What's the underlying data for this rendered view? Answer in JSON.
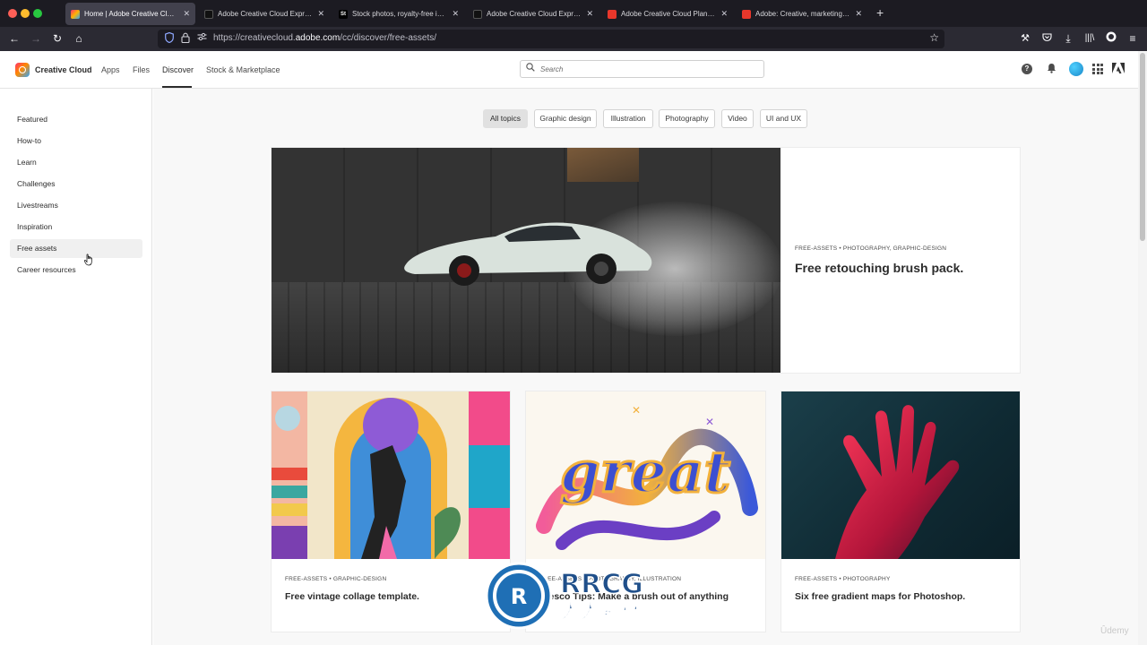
{
  "browser": {
    "tabs": [
      {
        "label": "Home | Adobe Creative Cloud",
        "favicon": "creative-cloud-icon",
        "active": true
      },
      {
        "label": "Adobe Creative Cloud Express",
        "favicon": "express-icon"
      },
      {
        "label": "Stock photos, royalty-free imag",
        "favicon": "stock-icon"
      },
      {
        "label": "Adobe Creative Cloud Express",
        "favicon": "express-icon"
      },
      {
        "label": "Adobe Creative Cloud Plans, Pr",
        "favicon": "adobe-icon"
      },
      {
        "label": "Adobe: Creative, marketing and",
        "favicon": "adobe-icon"
      }
    ],
    "stock_favicon_text": "St",
    "url_prefix": "https://creativecloud.",
    "url_domain": "adobe.com",
    "url_path": "/cc/discover/free-assets/"
  },
  "header": {
    "brand": "Creative Cloud",
    "nav": [
      "Apps",
      "Files",
      "Discover",
      "Stock & Marketplace"
    ],
    "active_nav": "Discover",
    "search_placeholder": "Search",
    "help_glyph": "?"
  },
  "sidebar": {
    "items": [
      {
        "label": "Featured"
      },
      {
        "label": "How-to"
      },
      {
        "label": "Learn"
      },
      {
        "label": "Challenges"
      },
      {
        "label": "Livestreams"
      },
      {
        "label": "Inspiration"
      },
      {
        "label": "Free assets",
        "active": true
      },
      {
        "label": "Career resources"
      }
    ]
  },
  "filters": {
    "chips": [
      "All topics",
      "Graphic design",
      "Illustration",
      "Photography",
      "Video",
      "UI and UX"
    ],
    "active": "All topics"
  },
  "hero": {
    "eyebrow": "FREE-ASSETS • PHOTOGRAPHY, GRAPHIC-DESIGN",
    "title": "Free retouching brush pack."
  },
  "cards": [
    {
      "eyebrow": "FREE-ASSETS • GRAPHIC-DESIGN",
      "title": "Free vintage collage template."
    },
    {
      "eyebrow": "FREE-ASSETS • PHOTOGRAPHY, ILLUSTRATION",
      "title": "Fresco Tips: Make a brush out of anything"
    },
    {
      "eyebrow": "FREE-ASSETS • PHOTOGRAPHY",
      "title": "Six free gradient maps for Photoshop."
    }
  ],
  "lettering_text": "great",
  "watermark": {
    "text": "RRCG",
    "subtext": "人人素材"
  },
  "udemy_mark": "Ûdemy",
  "colors": {
    "chrome_dark": "#1c1b22",
    "toolbar": "#2b2a33",
    "main_bg": "#f8f8f8",
    "chip_active": "#e1e1e1"
  }
}
